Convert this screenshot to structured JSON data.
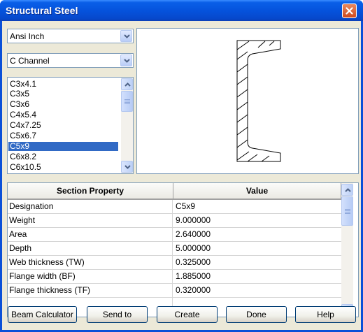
{
  "window": {
    "title": "Structural Steel"
  },
  "standard_select": {
    "value": "Ansi Inch"
  },
  "shape_select": {
    "value": "C Channel"
  },
  "sections": {
    "items": [
      "C3x4.1",
      "C3x5",
      "C3x6",
      "C4x5.4",
      "C4x7.25",
      "C5x6.7",
      "C5x9",
      "C6x8.2",
      "C6x10.5"
    ],
    "selected": "C5x9"
  },
  "properties": {
    "headers": [
      "Section Property",
      "Value"
    ],
    "rows": [
      [
        "Designation",
        "C5x9"
      ],
      [
        "Weight",
        "9.000000"
      ],
      [
        "Area",
        "2.640000"
      ],
      [
        "Depth",
        "5.000000"
      ],
      [
        "Web thickness (TW)",
        "0.325000"
      ],
      [
        "Flange width (BF)",
        "1.885000"
      ],
      [
        "Flange thickness (TF)",
        "0.320000"
      ]
    ]
  },
  "buttons": {
    "beam_calculator": "Beam Calculator",
    "send_to": "Send to",
    "create": "Create",
    "done": "Done",
    "help": "Help"
  },
  "colors": {
    "titlebar": "#0553dd",
    "selection": "#316ac5",
    "dialog_bg": "#ece9d8",
    "close_button": "#cf4a1e"
  },
  "icons": [
    "close-icon",
    "chevron-down-icon",
    "chevron-up-icon"
  ]
}
